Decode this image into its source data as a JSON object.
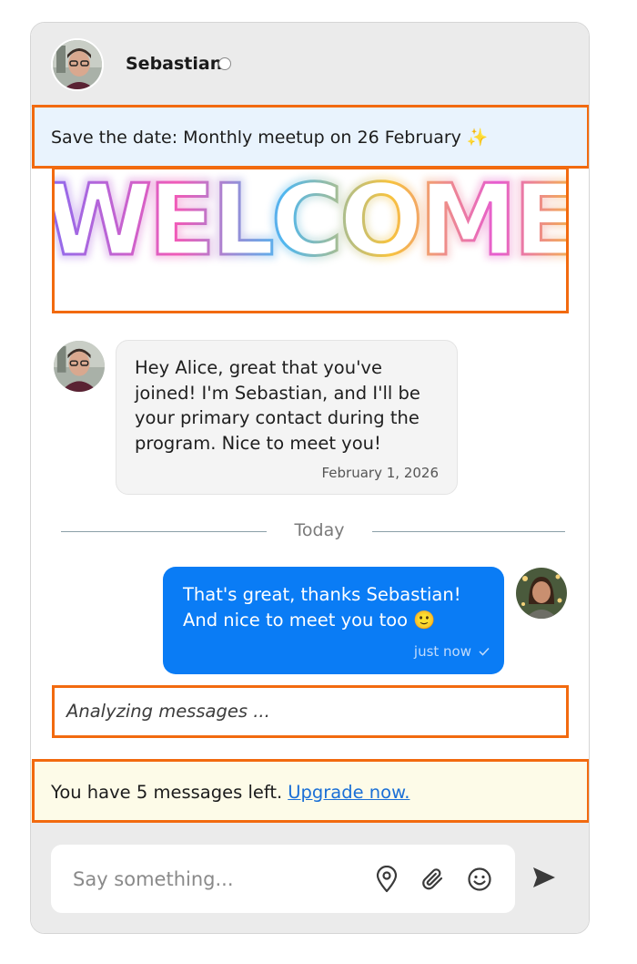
{
  "header": {
    "contact_name": "Sebastian",
    "status": "offline"
  },
  "announcement": {
    "text": "Save the date: Monthly meetup on 26 February ✨"
  },
  "banner": {
    "word": "WELCOME"
  },
  "messages": [
    {
      "direction": "incoming",
      "text": "Hey Alice, great that you've joined! I'm Sebastian, and I'll be your primary contact during the program. Nice to meet you!",
      "time": "February 1, 2026"
    },
    {
      "direction": "outgoing",
      "text": "That's great, thanks Sebastian! And nice to meet you too 🙂",
      "time": "just now",
      "status_icon": "check-icon"
    }
  ],
  "divider": {
    "label": "Today"
  },
  "analyzing": {
    "text": "Analyzing messages ..."
  },
  "limit": {
    "text": "You have 5 messages left.",
    "link": "Upgrade now."
  },
  "composer": {
    "placeholder": "Say something...",
    "icons": [
      "location-pin-icon",
      "paperclip-icon",
      "smiley-icon"
    ],
    "send_icon": "send-icon"
  },
  "colors": {
    "accent": "#0a7cf5",
    "highlight_outline": "#f26a0f",
    "announcement_bg": "#e9f3fd",
    "limit_bg": "#fdfbe8"
  }
}
